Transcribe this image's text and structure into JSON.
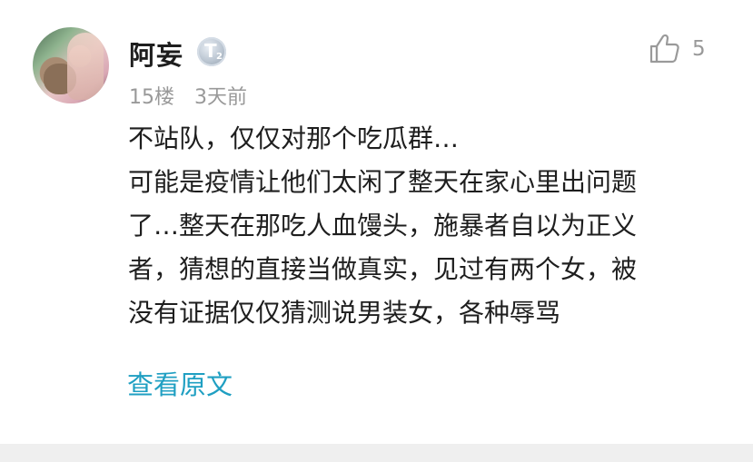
{
  "comment": {
    "username": "阿妄",
    "level_badge": {
      "letter": "T",
      "number": "2"
    },
    "floor": "15楼",
    "time": "3天前",
    "likes": "5",
    "content_lines": [
      "不站队，仅仅对那个吃瓜群…",
      "可能是疫情让他们太闲了整天在家心里出问题",
      "了…整天在那吃人血馒头，施暴者自以为正义",
      "者，猜想的直接当做真实，见过有两个女，被",
      "没有证据仅仅猜测说男装女，各种辱骂"
    ],
    "view_original_label": "查看原文"
  },
  "colors": {
    "link": "#1f9fc2",
    "meta_text": "#999999",
    "body_text": "#1e1e1e",
    "footer_band": "#efefef"
  },
  "icons": {
    "like": "thumbs-up-outline-icon",
    "level": "silver-level-badge-icon"
  }
}
